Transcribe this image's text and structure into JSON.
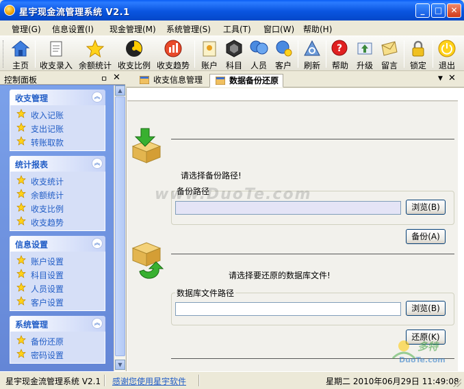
{
  "window": {
    "title": "星宇现金流管理系统 V2.1",
    "minimize_glyph": "_",
    "maximize_glyph": "□",
    "close_glyph": "✕"
  },
  "menu": [
    {
      "label": "管理(G)"
    },
    {
      "label": "信息设置(I)"
    },
    {
      "label": "现金管理(M)"
    },
    {
      "label": "系统管理(S)"
    },
    {
      "label": "工具(T)"
    },
    {
      "label": "窗口(W)"
    },
    {
      "label": "帮助(H)"
    }
  ],
  "toolbar": [
    {
      "label": "主页",
      "icon": "home-icon"
    },
    {
      "label": "收支录入",
      "icon": "entry-icon"
    },
    {
      "label": "余额统计",
      "icon": "star-icon"
    },
    {
      "label": "收支比例",
      "icon": "ratio-icon"
    },
    {
      "label": "收支趋势",
      "icon": "trend-icon"
    },
    {
      "label": "账户",
      "icon": "account-icon"
    },
    {
      "label": "科目",
      "icon": "subject-icon"
    },
    {
      "label": "人员",
      "icon": "people-icon"
    },
    {
      "label": "客户",
      "icon": "customer-icon"
    },
    {
      "label": "刷新",
      "icon": "refresh-icon"
    },
    {
      "label": "帮助",
      "icon": "help-icon"
    },
    {
      "label": "升级",
      "icon": "upgrade-icon"
    },
    {
      "label": "留言",
      "icon": "message-icon"
    },
    {
      "label": "锁定",
      "icon": "lock-icon"
    },
    {
      "label": "退出",
      "icon": "exit-icon"
    }
  ],
  "panel": {
    "title": "控制面板",
    "pin_glyph": "ㅁ",
    "close_glyph": "✕",
    "groups": [
      {
        "title": "收支管理",
        "items": [
          "收入记账",
          "支出记账",
          "转账取款"
        ]
      },
      {
        "title": "统计报表",
        "items": [
          "收支统计",
          "余额统计",
          "收支比例",
          "收支趋势"
        ]
      },
      {
        "title": "信息设置",
        "items": [
          "账户设置",
          "科目设置",
          "人员设置",
          "客户设置"
        ]
      },
      {
        "title": "系统管理",
        "items": [
          "备份还原",
          "密码设置"
        ]
      }
    ]
  },
  "tabs": [
    {
      "label": "收支信息管理",
      "active": false
    },
    {
      "label": "数据备份还原",
      "active": true
    }
  ],
  "backup": {
    "prompt": "请选择备份路径!",
    "legend": "备份路径",
    "path_value": "",
    "browse_label": "浏览(B)",
    "action_label": "备份(A)"
  },
  "restore": {
    "prompt": "请选择要还原的数据库文件!",
    "legend": "数据库文件路径",
    "path_value": "",
    "browse_label": "浏览(B)",
    "action_label": "还原(K)"
  },
  "watermark": "www.DuoTe.com",
  "corner_logo": {
    "line1": "多特",
    "line2": "DuoTe.com"
  },
  "status": {
    "app": "星宇现金流管理系统 V2.1",
    "thanks": "感谢您使用星宇软件",
    "datetime": "星期二 2010年06月29日 11:49:08"
  },
  "colors": {
    "titlebar": "#0a55e0",
    "panel_link": "#215dc6",
    "panel_bg": "#6f8fd8"
  }
}
